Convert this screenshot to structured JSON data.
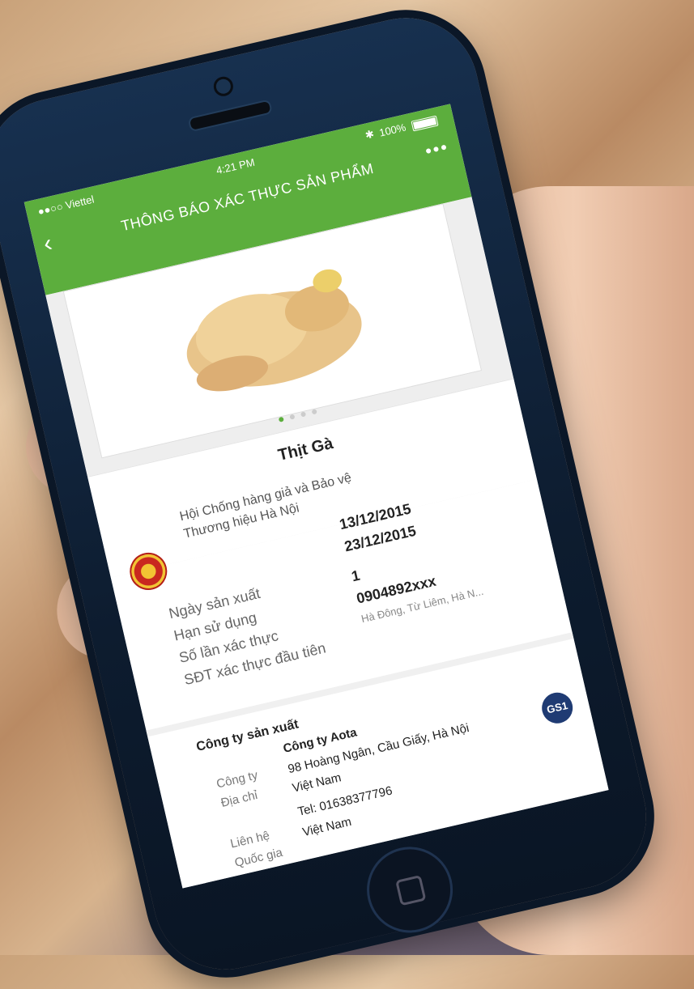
{
  "status_bar": {
    "carrier": "●●○○ Viettel",
    "time": "4:21 PM",
    "battery": "100%"
  },
  "nav": {
    "title": "THÔNG BÁO XÁC THỰC SẢN PHẨM",
    "more": "•••"
  },
  "gallery": {
    "dots_count": 4,
    "active_index": 0
  },
  "product": {
    "name": "Thịt Gà"
  },
  "organization": {
    "line1": "Hội Chống hàng giả và Bảo vệ",
    "line2": "Thương hiệu Hà Nội"
  },
  "details": {
    "rows": [
      {
        "label": "Ngày sản xuất",
        "value": "13/12/2015"
      },
      {
        "label": "Hạn sử dụng",
        "value": "23/12/2015"
      },
      {
        "label": "Số lần xác thực",
        "value": "1"
      },
      {
        "label": "SĐT xác thực đầu tiên",
        "value": "0904892xxx"
      }
    ],
    "location": "Hà Đông, Từ Liêm, Hà N..."
  },
  "producer": {
    "section_title": "Công ty sản xuất",
    "company_label": "Công ty",
    "company_value": "Công ty Aota",
    "address_label": "Địa chỉ",
    "address_value_1": "98 Hoàng Ngân, Cầu Giấy, Hà Nội",
    "address_value_2": "Việt Nam",
    "contact_label": "Liên hệ",
    "contact_value": "Tel: 01638377796",
    "country_label": "Quốc gia",
    "country_value": "Việt Nam",
    "logo_text": "GS1"
  },
  "colors": {
    "header_green": "#5cae3d",
    "phone_body": "#0d1c2f"
  }
}
